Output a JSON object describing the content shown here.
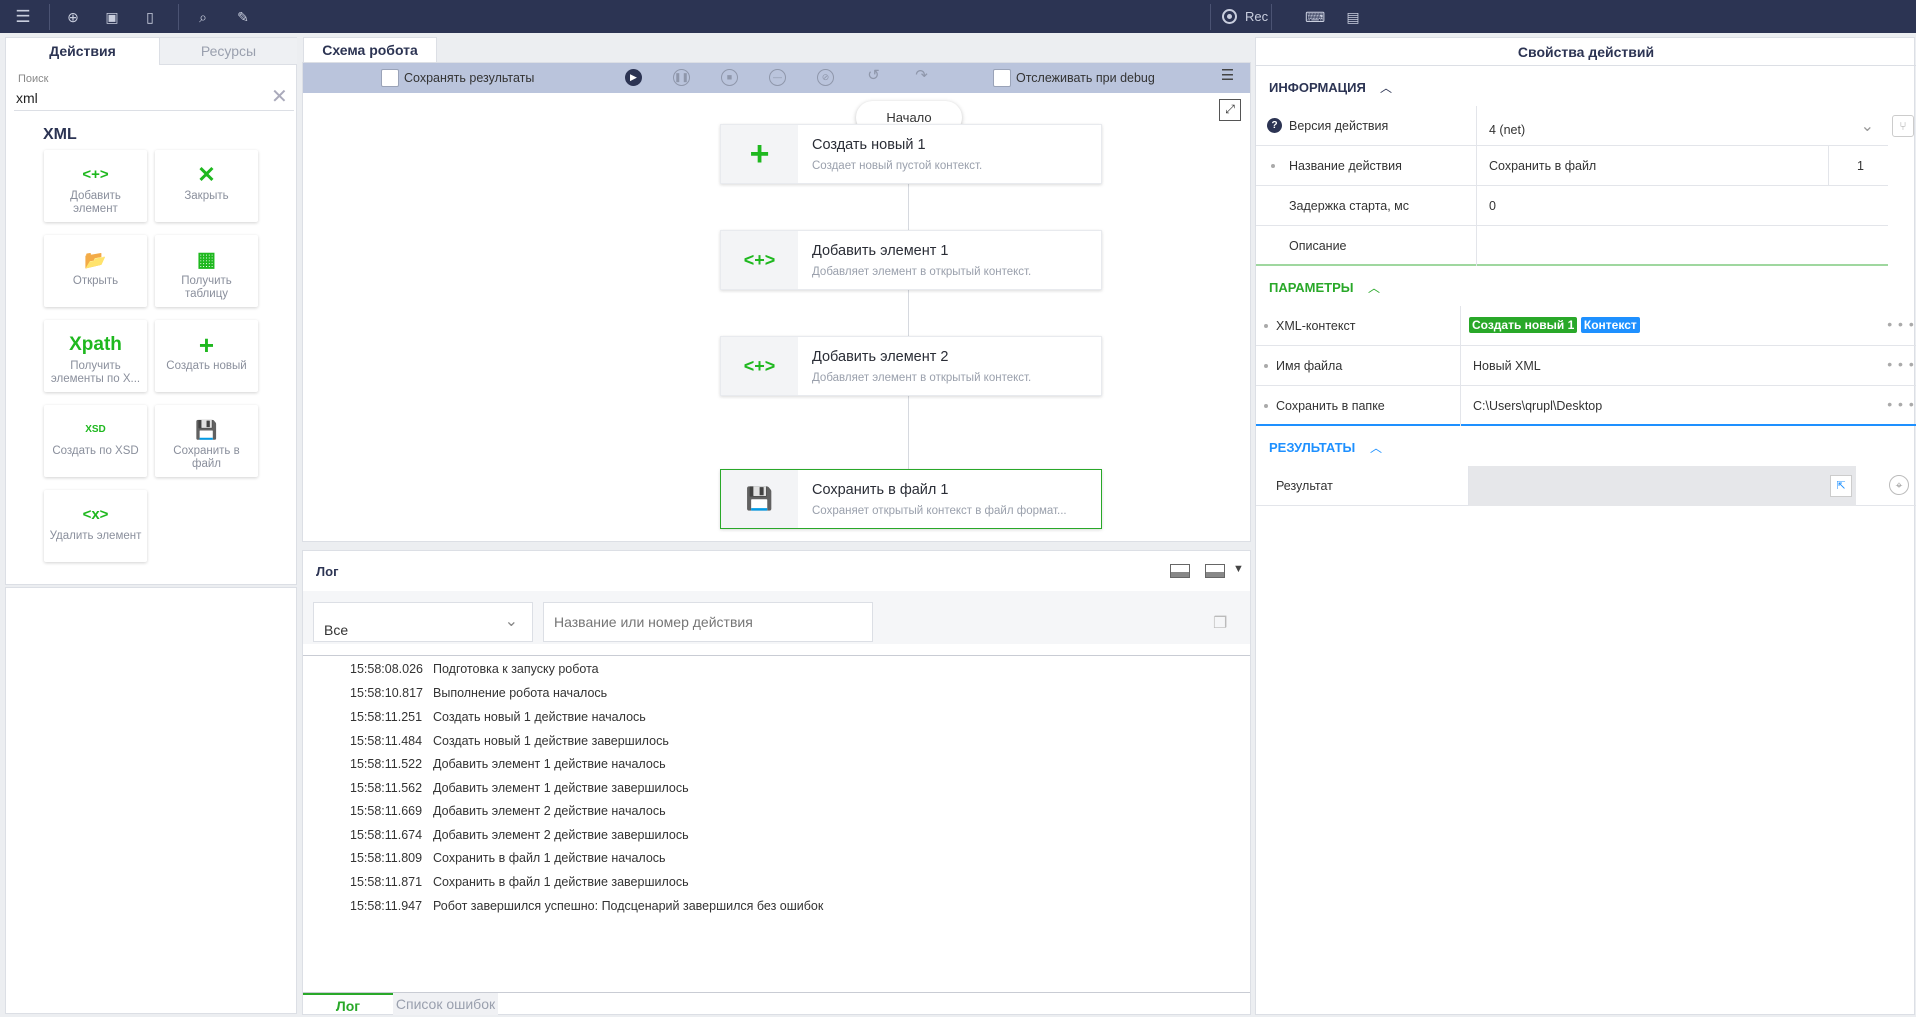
{
  "toolbar": {
    "rec_label": "Rec"
  },
  "left": {
    "tab_actions": "Действия",
    "tab_resources": "Ресурсы",
    "search_label": "Поиск",
    "search_value": "xml",
    "group_title": "XML",
    "tiles": [
      {
        "icon": "<+>",
        "label": "Добавить элемент"
      },
      {
        "icon": "✕",
        "label": "Закрыть"
      },
      {
        "icon": "📂",
        "label": "Открыть"
      },
      {
        "icon": "▦",
        "label": "Получить таблицу"
      },
      {
        "icon": "Xpath",
        "label": "Получить элементы по X..."
      },
      {
        "icon": "+",
        "label": "Создать новый"
      },
      {
        "icon": "XSD",
        "label": "Создать по XSD"
      },
      {
        "icon": "💾",
        "label": "Сохранить в файл"
      },
      {
        "icon": "<x>",
        "label": "Удалить элемент"
      }
    ]
  },
  "schema": {
    "tab": "Схема робота",
    "save_results": "Сохранять результаты",
    "track_debug": "Отслеживать при debug",
    "start": "Начало",
    "nodes": [
      {
        "icon": "+",
        "title": "Создать новый  1",
        "desc": "Создает новый пустой контекст."
      },
      {
        "icon": "<+>",
        "title": "Добавить элемент  1",
        "desc": "Добавляет элемент в открытый контекст."
      },
      {
        "icon": "<+>",
        "title": "Добавить элемент  2",
        "desc": "Добавляет элемент в открытый контекст."
      },
      {
        "icon": "💾",
        "title": "Сохранить в файл  1",
        "desc": "Сохраняет открытый контекст в файл формат..."
      }
    ]
  },
  "log": {
    "title": "Лог",
    "filter_value": "Все",
    "search_placeholder": "Название или номер действия",
    "rows": [
      {
        "time": "15:58:08.026",
        "msg": "Подготовка к запуску робота"
      },
      {
        "time": "15:58:10.817",
        "msg": "Выполнение робота началось"
      },
      {
        "time": "15:58:11.251",
        "msg": "Создать новый 1 действие началось"
      },
      {
        "time": "15:58:11.484",
        "msg": "Создать новый 1 действие завершилось"
      },
      {
        "time": "15:58:11.522",
        "msg": "Добавить элемент 1 действие началось"
      },
      {
        "time": "15:58:11.562",
        "msg": "Добавить элемент 1 действие завершилось"
      },
      {
        "time": "15:58:11.669",
        "msg": "Добавить элемент 2 действие началось"
      },
      {
        "time": "15:58:11.674",
        "msg": "Добавить элемент 2 действие завершилось"
      },
      {
        "time": "15:58:11.809",
        "msg": "Сохранить в файл 1 действие началось"
      },
      {
        "time": "15:58:11.871",
        "msg": "Сохранить в файл 1 действие завершилось"
      },
      {
        "time": "15:58:11.947",
        "msg": "Робот завершился успешно: Подсценарий завершился без ошибок"
      }
    ],
    "tab_log": "Лог",
    "tab_errors": "Список ошибок"
  },
  "props": {
    "title": "Свойства действий",
    "info_head": "ИНФОРМАЦИЯ",
    "version_label": "Версия действия",
    "version_value": "4 (net)",
    "name_label": "Название действия",
    "name_value": "Сохранить в файл",
    "name_num": "1",
    "delay_label": "Задержка старта, мс",
    "delay_value": "0",
    "desc_label": "Описание",
    "params_head": "ПАРАМЕТРЫ",
    "ctx_label": "XML-контекст",
    "ctx_tag1": "Создать новый 1",
    "ctx_tag2": "Контекст",
    "file_label": "Имя файла",
    "file_value": "Новый XML",
    "folder_label": "Сохранить в папке",
    "folder_value": "C:\\Users\\qrupl\\Desktop",
    "results_head": "РЕЗУЛЬТАТЫ",
    "result_label": "Результат"
  },
  "colors": {
    "topbar": "#2c3453",
    "accent_green": "#1fb81f",
    "accent_blue": "#1e90ff"
  }
}
